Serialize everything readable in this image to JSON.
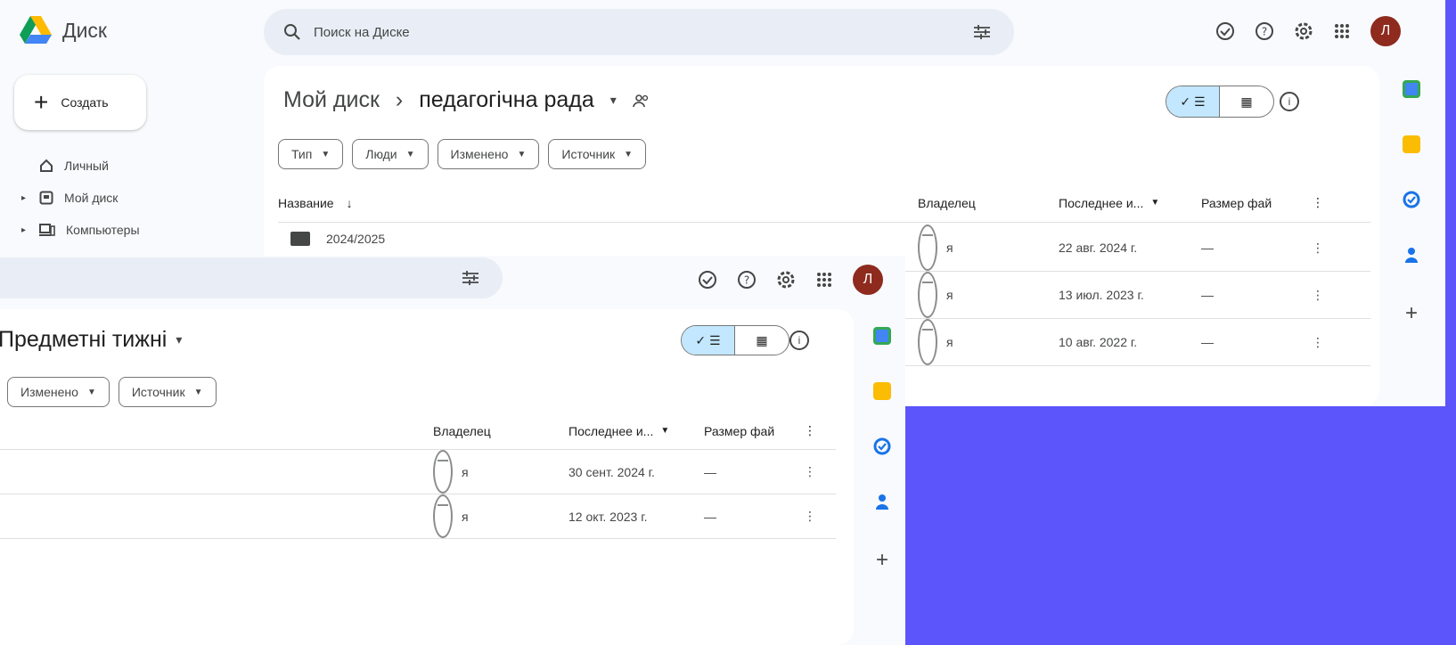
{
  "colors": {
    "accent_bg": "#5b55fb",
    "toggle_on": "#c2e7ff",
    "avatar": "#8e2a1e"
  },
  "back_window": {
    "app_name": "Диск",
    "search_placeholder": "Поиск на Диске",
    "create_label": "Создать",
    "nav": [
      {
        "label": "Личный",
        "icon": "home-icon"
      },
      {
        "label": "Мой диск",
        "icon": "drive-icon"
      },
      {
        "label": "Компьютеры",
        "icon": "computer-icon"
      }
    ],
    "avatar_letter": "Л",
    "breadcrumb_root": "Мой диск",
    "breadcrumb_sep": "›",
    "breadcrumb_current": "педагогічна рада",
    "filters": [
      "Тип",
      "Люди",
      "Изменено",
      "Источник"
    ],
    "columns": {
      "name": "Название",
      "owner": "Владелец",
      "modified": "Последнее и...",
      "size": "Размер фай"
    },
    "partial_row_name": "2024/2025",
    "rows": [
      {
        "owner": "я",
        "modified": "22 авг. 2024 г.",
        "size": "—"
      },
      {
        "owner": "я",
        "modified": "13 июл. 2023 г.",
        "size": "—"
      },
      {
        "owner": "я",
        "modified": "10 авг. 2022 г.",
        "size": "—"
      }
    ]
  },
  "front_window": {
    "avatar_letter": "Л",
    "breadcrumb_current": "Предметні тижні",
    "filters": [
      "Изменено",
      "Источник"
    ],
    "columns": {
      "owner": "Владелец",
      "modified": "Последнее и...",
      "size": "Размер фай"
    },
    "rows": [
      {
        "owner": "я",
        "modified": "30 сент. 2024 г.",
        "size": "—"
      },
      {
        "owner": "я",
        "modified": "12 окт. 2023 г.",
        "size": "—"
      }
    ]
  }
}
